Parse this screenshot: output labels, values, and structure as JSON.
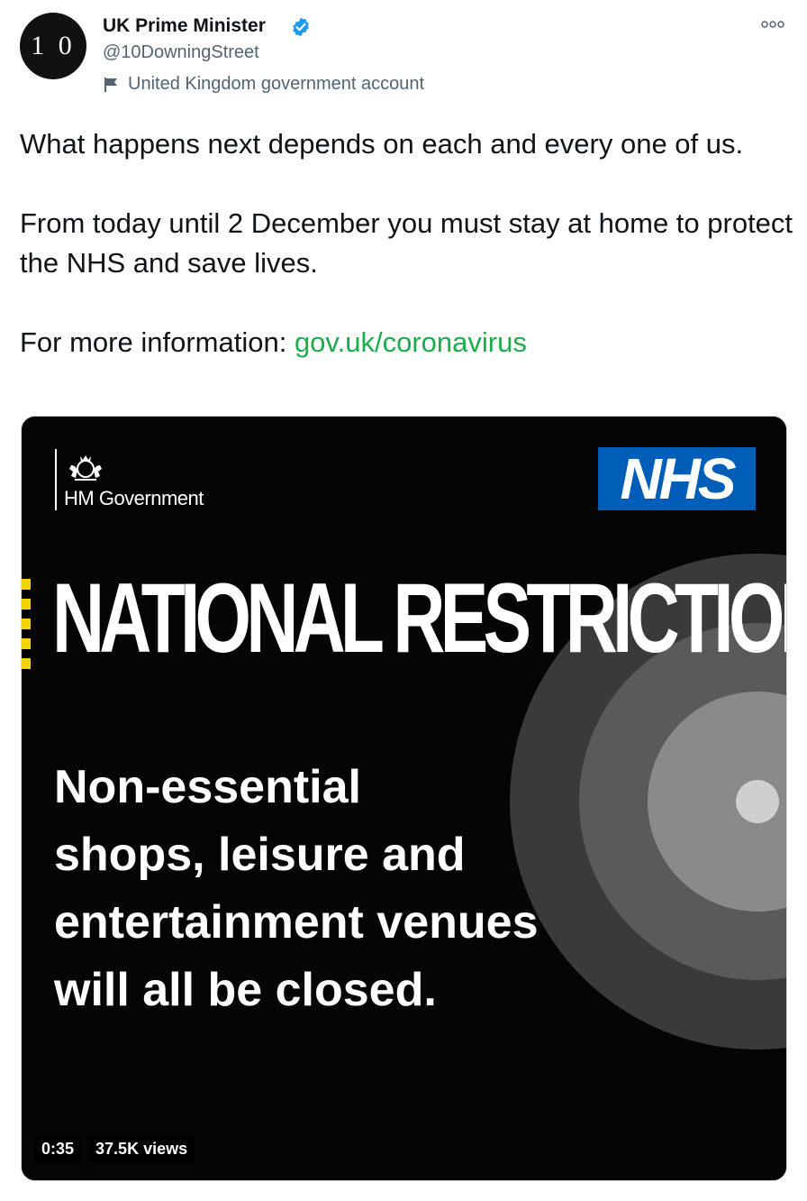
{
  "account": {
    "avatar_text": "1 0",
    "display_name": "UK Prime Minister",
    "handle": "@10DowningStreet",
    "label": "United Kingdom government account"
  },
  "tweet": {
    "line1": "What happens next depends on each and every one of us.",
    "line2": "From today until 2 December you must stay at home to protect the NHS and save lives.",
    "line3_prefix": "For more information: ",
    "link_text": "gov.uk/coronavirus"
  },
  "media": {
    "brand": "HM Government",
    "nhs_logo": "NHS",
    "headline": "NATIONAL RESTRICTIONS",
    "body_lines": [
      "Non-essential",
      "shops, leisure and",
      "entertainment venues",
      "will all be closed."
    ],
    "duration": "0:35",
    "views": "37.5K views"
  },
  "colors": {
    "link": "#1aae4a",
    "verified": "#1d9bf0",
    "nhs_blue": "#005eb8",
    "hazard_yellow": "#f5d300"
  },
  "icons": [
    "verified-icon",
    "flag-icon",
    "more-icon",
    "crest-icon"
  ]
}
